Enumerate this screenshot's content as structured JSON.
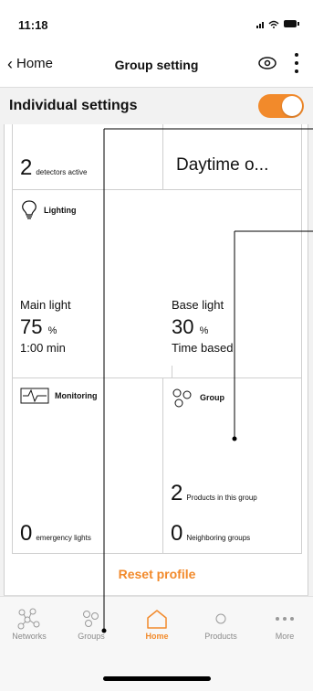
{
  "status": {
    "time": "11:18",
    "icons": "..ıl ᯤ ▬"
  },
  "nav": {
    "back_label": "Home",
    "title": "Group setting"
  },
  "section": {
    "title": "Individual settings",
    "toggle_on": true
  },
  "tiles": {
    "detectors": {
      "count": "2",
      "label": "detectors active"
    },
    "daytime": {
      "text": "Daytime o..."
    },
    "lighting": {
      "title": "Lighting",
      "main": {
        "name": "Main light",
        "value": "75",
        "unit": "%",
        "sub": "1:00 min"
      },
      "base": {
        "name": "Base light",
        "value": "30",
        "unit": "%",
        "sub": "Time based"
      }
    },
    "monitoring": {
      "title": "Monitoring",
      "count": "0",
      "label": "emergency lights"
    },
    "group": {
      "title": "Group",
      "products_count": "2",
      "products_label": "Products in this group",
      "neighbor_count": "0",
      "neighbor_label": "Neighboring groups"
    }
  },
  "reset_label": "Reset profile",
  "tabs": [
    {
      "label": "Networks",
      "icon": "network-icon"
    },
    {
      "label": "Groups",
      "icon": "groups-icon"
    },
    {
      "label": "Home",
      "icon": "home-icon"
    },
    {
      "label": "Products",
      "icon": "products-icon"
    },
    {
      "label": "More",
      "icon": "more-icon"
    }
  ],
  "colors": {
    "accent": "#f28a2b",
    "inactive": "#8a8a8a"
  }
}
